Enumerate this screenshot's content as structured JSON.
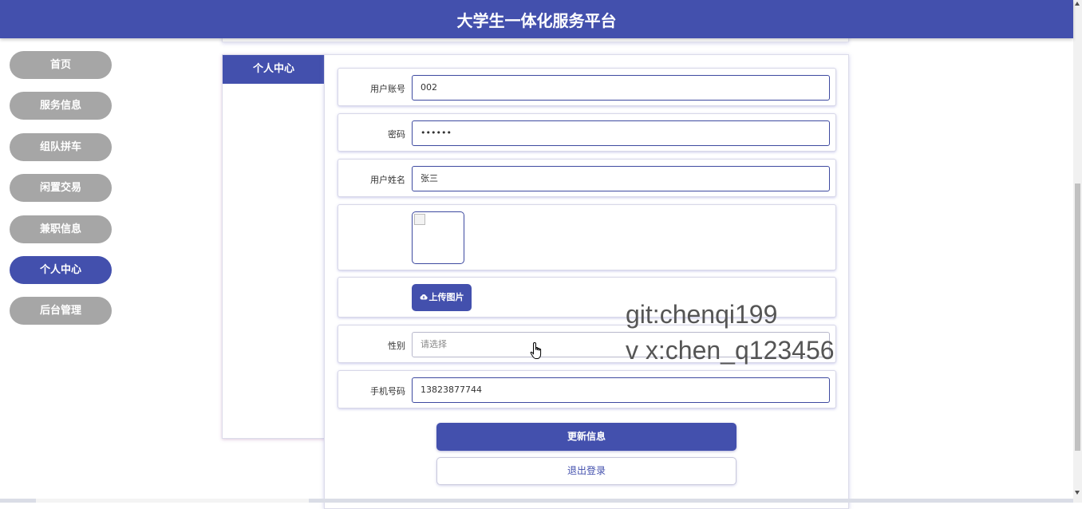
{
  "app": {
    "title": "大学生一体化服务平台"
  },
  "colors": {
    "accent": "#4350ad",
    "nav_inactive": "#a6a6a6"
  },
  "nav": {
    "items": [
      {
        "label": "首页",
        "active": false
      },
      {
        "label": "服务信息",
        "active": false
      },
      {
        "label": "组队拼车",
        "active": false
      },
      {
        "label": "闲置交易",
        "active": false
      },
      {
        "label": "兼职信息",
        "active": false
      },
      {
        "label": "个人中心",
        "active": true
      },
      {
        "label": "后台管理",
        "active": false
      }
    ]
  },
  "side_panel": {
    "tab_label": "个人中心"
  },
  "form": {
    "account": {
      "label": "用户账号",
      "value": "002"
    },
    "password": {
      "label": "密码",
      "value": "••••••"
    },
    "name": {
      "label": "用户姓名",
      "value": "张三"
    },
    "upload_label": "上传图片",
    "upload_icon": "cloud-upload-icon",
    "gender": {
      "label": "性别",
      "placeholder": "请选择"
    },
    "phone": {
      "label": "手机号码",
      "value": "13823877744"
    }
  },
  "buttons": {
    "update": "更新信息",
    "logout": "退出登录"
  },
  "watermark": {
    "line1": "git:chenqi199",
    "line2": "v x:chen_q123456"
  }
}
